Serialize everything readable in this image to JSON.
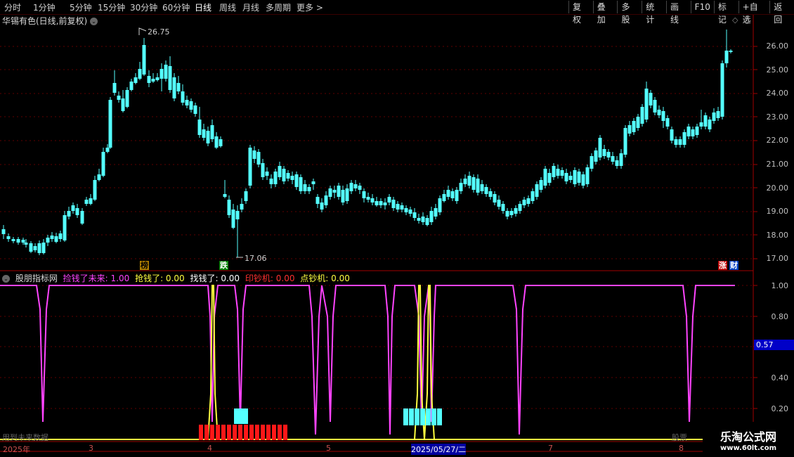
{
  "toolbar": {
    "periods": [
      "分时",
      "1分钟",
      "5分钟",
      "15分钟",
      "30分钟",
      "60分钟",
      "日线",
      "周线",
      "月线",
      "多周期",
      "更多 >"
    ],
    "active_period": "日线",
    "buttons": [
      "复权",
      "叠加",
      "多股",
      "统计",
      "画线",
      "F10",
      "标记",
      "+自选",
      "返回"
    ]
  },
  "stock": {
    "title": "华锡有色(日线,前复权)"
  },
  "price_axis": [
    "26.00",
    "25.00",
    "24.00",
    "23.00",
    "22.00",
    "21.00",
    "20.00",
    "19.00",
    "18.00",
    "17.00"
  ],
  "annotations": {
    "high": "26.75",
    "low": "17.06"
  },
  "badges": {
    "bang": "榜",
    "die": "跌",
    "zhang": "涨",
    "cai": "财"
  },
  "indicator": {
    "name": "股朋指标网",
    "items": [
      {
        "label": "捡钱了未来: 1.00",
        "color": "#ff44ff"
      },
      {
        "label": "抢钱了: 0.00",
        "color": "#ffff40"
      },
      {
        "label": "找钱了: 0.00",
        "color": "#ffffff"
      },
      {
        "label": "印钞机: 0.00",
        "color": "#ff3030"
      },
      {
        "label": "点钞机: 0.00",
        "color": "#ffff40"
      }
    ],
    "axis": [
      "1.00",
      "0.80",
      "0.40",
      "0.20"
    ],
    "current_value": "0.57",
    "footer_left": "用到未来数据",
    "footer_right": "股票"
  },
  "x_axis": {
    "labels": [
      "2025年",
      "3",
      "4",
      "5",
      "2025/05/27/二",
      "7",
      "8"
    ]
  },
  "watermark": {
    "line1": "乐淘公式网",
    "line2": "www.60lt.com"
  },
  "colors": {
    "up": "#ff4444",
    "down": "#54ffff",
    "magenta": "#ff44ff",
    "yellow": "#ffff40"
  }
}
